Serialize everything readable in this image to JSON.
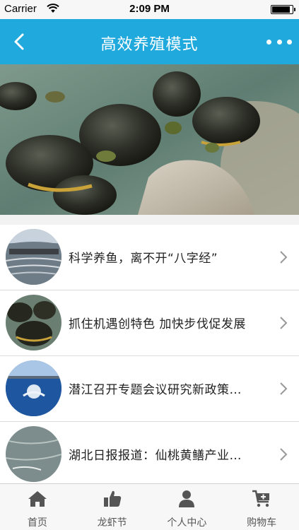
{
  "status_bar": {
    "carrier": "Carrier",
    "time": "2:09 PM",
    "battery_level": 0.92
  },
  "nav": {
    "title": "高效养殖模式",
    "back_icon": "chevron-left-icon",
    "more_icon": "more-dots-icon"
  },
  "banner": {
    "image": "turtles-on-rock-photo",
    "page_count": 1,
    "current_page": 1
  },
  "articles": [
    {
      "title": "科学养鱼，离不开“八字经”",
      "thumb": "fish-pond-nets-photo"
    },
    {
      "title": "抓住机遇创特色 加快步伐促发展",
      "thumb": "turtles-photo"
    },
    {
      "title": "潜江召开专题会议研究新政策…",
      "thumb": "aerator-pond-photo"
    },
    {
      "title": "湖北日报报道：仙桃黄鳝产业…",
      "thumb": "eel-water-photo"
    }
  ],
  "tabs": [
    {
      "label": "首页",
      "icon": "home-icon"
    },
    {
      "label": "龙虾节",
      "icon": "thumbs-up-icon"
    },
    {
      "label": "个人中心",
      "icon": "person-icon"
    },
    {
      "label": "购物车",
      "icon": "cart-icon"
    }
  ],
  "colors": {
    "nav_background": "#1fa9dd",
    "tab_background": "#f7f7f7",
    "text": "#222222"
  }
}
